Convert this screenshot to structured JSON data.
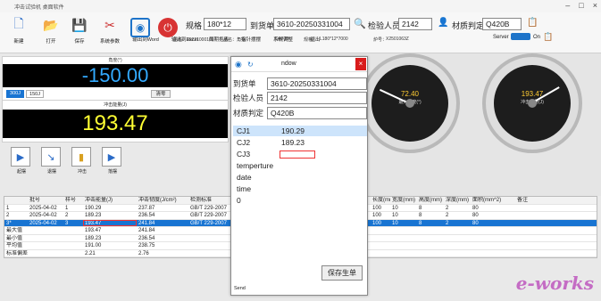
{
  "window": {
    "title": "冲击试验机 桌面软件"
  },
  "toolbar": {
    "items": [
      {
        "label": "新建",
        "icon": "new-icon",
        "glyph": "🗋"
      },
      {
        "label": "打开",
        "icon": "open-icon",
        "glyph": "📂"
      },
      {
        "label": "保存",
        "icon": "save-icon",
        "glyph": "💾"
      },
      {
        "label": "系统参数",
        "icon": "tools-icon",
        "glyph": "✂"
      },
      {
        "label": "输出到Word",
        "icon": "word-icon",
        "glyph": ""
      },
      {
        "label": "输出到Excel",
        "icon": "excel-icon",
        "glyph": ""
      },
      {
        "label": "周期抱表",
        "icon": "report-icon",
        "glyph": ""
      },
      {
        "label": "指针摆摆",
        "icon": "pointer-icon",
        "glyph": ""
      },
      {
        "label": "系统调整",
        "icon": "adjust-icon",
        "glyph": ""
      },
      {
        "label": "退出",
        "icon": "exit-icon",
        "glyph": ""
      }
    ]
  },
  "header": {
    "spec_label": "规格",
    "spec_value": "180*12",
    "order_label": "到货单",
    "order_value": "3610-20250331004",
    "inspector_label": "检验人员",
    "inspector_value": "2142",
    "material_label": "材质判定",
    "material_value": "Q420B",
    "server_label": "Server",
    "on_label": "On",
    "pinming": "品名：30221000101",
    "pinming2": "品名：角钢",
    "pinming_val": "Q420B",
    "guige": "规格：",
    "guige_val": "L180*12*7000",
    "luhao": "炉号：",
    "luhao_val": "X2501063Z"
  },
  "angle_panel": {
    "label": "角度(°)",
    "value": "-150.00",
    "btn1": "300J",
    "btn2": "150J",
    "clear": "清零"
  },
  "energy_panel": {
    "label": "冲击能量(J)",
    "value": "193.47"
  },
  "actions": [
    {
      "label": "起摆"
    },
    {
      "label": "退摆"
    },
    {
      "label": "冲击"
    },
    {
      "label": "落摆"
    }
  ],
  "gauges": [
    {
      "value": "72.40",
      "caption": "最大角度(°)",
      "needle_deg": 205
    },
    {
      "value": "193.47",
      "caption": "冲击能量(J)",
      "needle_deg": -30
    }
  ],
  "table": {
    "headers": [
      "",
      "批号",
      "样号",
      "冲击能量(J)",
      "冲击韧度(J/cm²)",
      "检测标准"
    ],
    "rows": [
      [
        "1",
        "2025-04-02",
        "1",
        "190.29",
        "237.87",
        "GB/T 229-2007"
      ],
      [
        "2",
        "2025-04-02",
        "2",
        "189.23",
        "236.54",
        "GB/T 229-2007"
      ],
      [
        "3*",
        "2025-04-02",
        "3",
        "193.47",
        "241.84",
        "GB/T 229-2007"
      ]
    ],
    "stats": [
      [
        "最大值",
        "",
        "",
        "193.47",
        "241.84",
        ""
      ],
      [
        "最小值",
        "",
        "",
        "189.23",
        "236.54",
        ""
      ],
      [
        "平均值",
        "",
        "",
        "191.00",
        "238.75",
        ""
      ],
      [
        "标准偏差",
        "",
        "",
        "2.21",
        "2.76",
        ""
      ]
    ],
    "right_headers": [
      "长度(mm)",
      "宽度(mm)",
      "高度(mm)",
      "深度(mm)",
      "面积(mm^2)",
      "备注"
    ],
    "right_rows": [
      [
        "100",
        "10",
        "8",
        "2",
        "80",
        ""
      ],
      [
        "100",
        "10",
        "8",
        "2",
        "80",
        ""
      ],
      [
        "100",
        "10",
        "8",
        "2",
        "80",
        ""
      ]
    ]
  },
  "dialog": {
    "title": "ndow",
    "order_label": "到货单",
    "order_value": "3610-20250331004",
    "inspector_label": "检验人员",
    "inspector_value": "2142",
    "material_label": "材质判定",
    "material_value": "Q420B",
    "list": [
      {
        "label": "CJ1",
        "value": "190.29"
      },
      {
        "label": "CJ2",
        "value": "189.23"
      },
      {
        "label": "CJ3",
        "value": ""
      },
      {
        "label": "temperture",
        "value": ""
      },
      {
        "label": "date",
        "value": ""
      },
      {
        "label": "time",
        "value": ""
      },
      {
        "label": "0",
        "value": ""
      }
    ],
    "save_label": "保存生单",
    "footer": "Send"
  },
  "watermark": "e-works"
}
